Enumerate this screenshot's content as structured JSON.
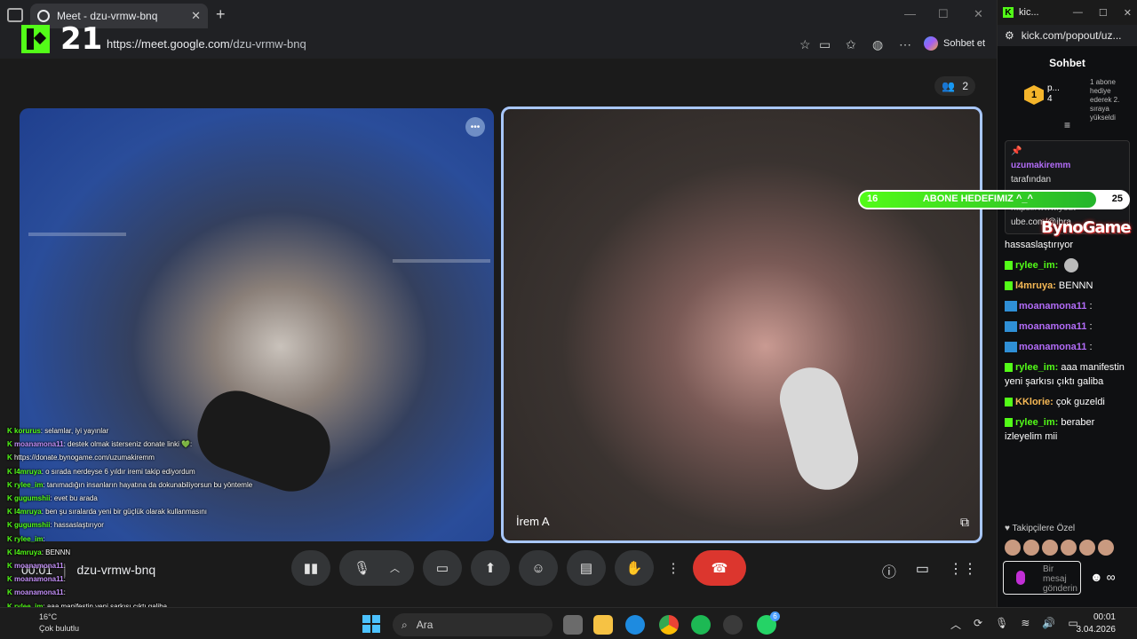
{
  "browser": {
    "tab_title": "Meet - dzu-vrmw-bnq",
    "url_host": "https://meet.google.com",
    "url_path": "/dzu-vrmw-bnq",
    "sohbet_label": "Sohbet et"
  },
  "stream_overlay": {
    "number": "21"
  },
  "meet": {
    "participant_count": "2",
    "right_tile_name": "İrem A",
    "meeting_code": "dzu-vrmw-bnq"
  },
  "overlay_chat": [
    {
      "user": "korurus",
      "text": ": selamlar, iyi yayınlar"
    },
    {
      "user": "moanamona11",
      "text": ": destek olmak isterseniz donate linki 💚:"
    },
    {
      "user": "",
      "text": "https://donate.bynogame.com/uzumakiremm"
    },
    {
      "user": "l4mruya",
      "text": ": o sırada nerdeyse 6 yıldır iremi takip ediyordum"
    },
    {
      "user": "rylee_im",
      "text": ": tanımadığın insanların hayatına da dokunabiliyorsun bu yöntemle"
    },
    {
      "user": "gugumshii",
      "text": ": evet bu arada"
    },
    {
      "user": "l4mruya",
      "text": ": ben şu sıralarda yeni bir güçlük olarak kullanmasını"
    },
    {
      "user": "gugumshii",
      "text": ": hassaslaştırıyor"
    },
    {
      "user": "rylee_im",
      "text": ":"
    },
    {
      "user": "l4mruya",
      "text": ": BENNN"
    },
    {
      "user": "moanamona11",
      "text": ":"
    },
    {
      "user": "moanamona11",
      "text": ":"
    },
    {
      "user": "moanamona11",
      "text": ":"
    },
    {
      "user": "rylee_im",
      "text": ": aaa manifestin yeni şarkısı çıktı galiba"
    },
    {
      "user": "kklorie",
      "text": ": çok guzeldi"
    },
    {
      "user": "rylee_im",
      "text": ": beraber izleyelim mii"
    }
  ],
  "overlay_timer": "00:01",
  "taskbar": {
    "weather_temp": "16°C",
    "weather_desc": "Çok bulutlu",
    "search_placeholder": "Ara",
    "time": "00:01",
    "date": "3.04.2026",
    "whatsapp_badge": "6"
  },
  "kick": {
    "tab_title": "kic...",
    "url": "kick.com/popout/uz...",
    "chat_title": "Sohbet",
    "gift_rank": "1",
    "gift_name": "p...",
    "gift_count": "4",
    "gift_side_text": "1 abone hediye ederek 2. sıraya yükseldi",
    "pinned_user": "uzumakiremm",
    "pinned_by": "tarafından",
    "pinned_link": "ube.com/@ibra",
    "pinned_partial": "https://www.yout",
    "goal_start": "16",
    "goal_title": "ABONE HEDEFIMIZ ^_^",
    "goal_end": "25",
    "brand_text": "BynoGame",
    "messages": [
      {
        "user": "",
        "text": "hassaslaştırıyor",
        "cls": ""
      },
      {
        "user": "rylee_im:",
        "text": "",
        "cls": "user-g"
      },
      {
        "user": "l4mruya:",
        "text": "BENNN",
        "cls": "user-o"
      },
      {
        "user": "moanamona11",
        "text": ":",
        "cls": "user-p"
      },
      {
        "user": "moanamona11",
        "text": ":",
        "cls": "user-p"
      },
      {
        "user": "moanamona11",
        "text": ":",
        "cls": "user-p"
      },
      {
        "user": "rylee_im:",
        "text": "aaa manifestin yeni şarkısı çıktı galiba",
        "cls": "user-g"
      },
      {
        "user": "KKlorie:",
        "text": "çok guzeldi",
        "cls": "user-o"
      },
      {
        "user": "rylee_im:",
        "text": "beraber izleyelim mii",
        "cls": "user-g"
      }
    ],
    "followers_label": "Takipçilere Özel",
    "input_placeholder": "Bir mesaj gönderin"
  }
}
